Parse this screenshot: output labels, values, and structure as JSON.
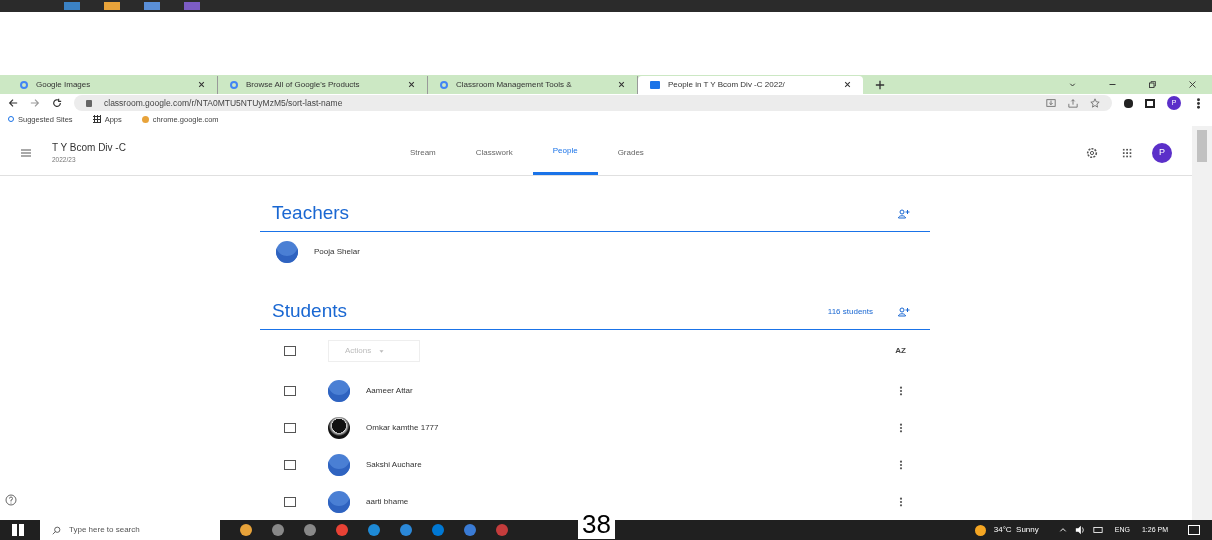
{
  "browser": {
    "tabs": [
      {
        "title": "Google Images",
        "kind": "google",
        "selected": false
      },
      {
        "title": "Browse All of Google's Products",
        "kind": "google",
        "selected": false
      },
      {
        "title": "Classroom Management Tools &",
        "kind": "google",
        "selected": false
      },
      {
        "title": "People in T Y Bcom Div -C 2022/",
        "kind": "classroom",
        "selected": true
      }
    ],
    "url": "classroom.google.com/r/NTA0MTU5NTUyMzM5/sort-last-name",
    "profile": "P",
    "bookmarks": [
      {
        "label": "Suggested Sites",
        "kind": "search"
      },
      {
        "label": "Apps",
        "kind": "apps"
      },
      {
        "label": "chrome.google.com",
        "kind": "site"
      }
    ]
  },
  "classroom": {
    "class_name": "T Y Bcom Div -C",
    "section": "2022/23",
    "profile": "P",
    "nav": [
      {
        "label": "Stream",
        "selected": false
      },
      {
        "label": "Classwork",
        "selected": false
      },
      {
        "label": "People",
        "selected": true
      },
      {
        "label": "Grades",
        "selected": false
      }
    ],
    "teachers_heading": "Teachers",
    "teachers": [
      {
        "name": "Pooja Shelar"
      }
    ],
    "students_heading": "Students",
    "student_count": "116 students",
    "actions": "Actions",
    "select_all_checked": false,
    "sort_label": "AZ",
    "students": [
      {
        "name": "Aameer Attar",
        "kind": "default",
        "checked": false
      },
      {
        "name": "Omkar kamthe 1777",
        "checked": false
      },
      {
        "name": "Sakshi Auchare",
        "kind": "default",
        "checked": false
      },
      {
        "name": "aarti bhame",
        "kind": "default",
        "checked": false
      }
    ]
  },
  "taskbar": {
    "search_placeholder": "Type here to search",
    "weather": "34°C  Sunny",
    "language": "ENG",
    "time": "1:26 PM"
  },
  "page_number": "38"
}
